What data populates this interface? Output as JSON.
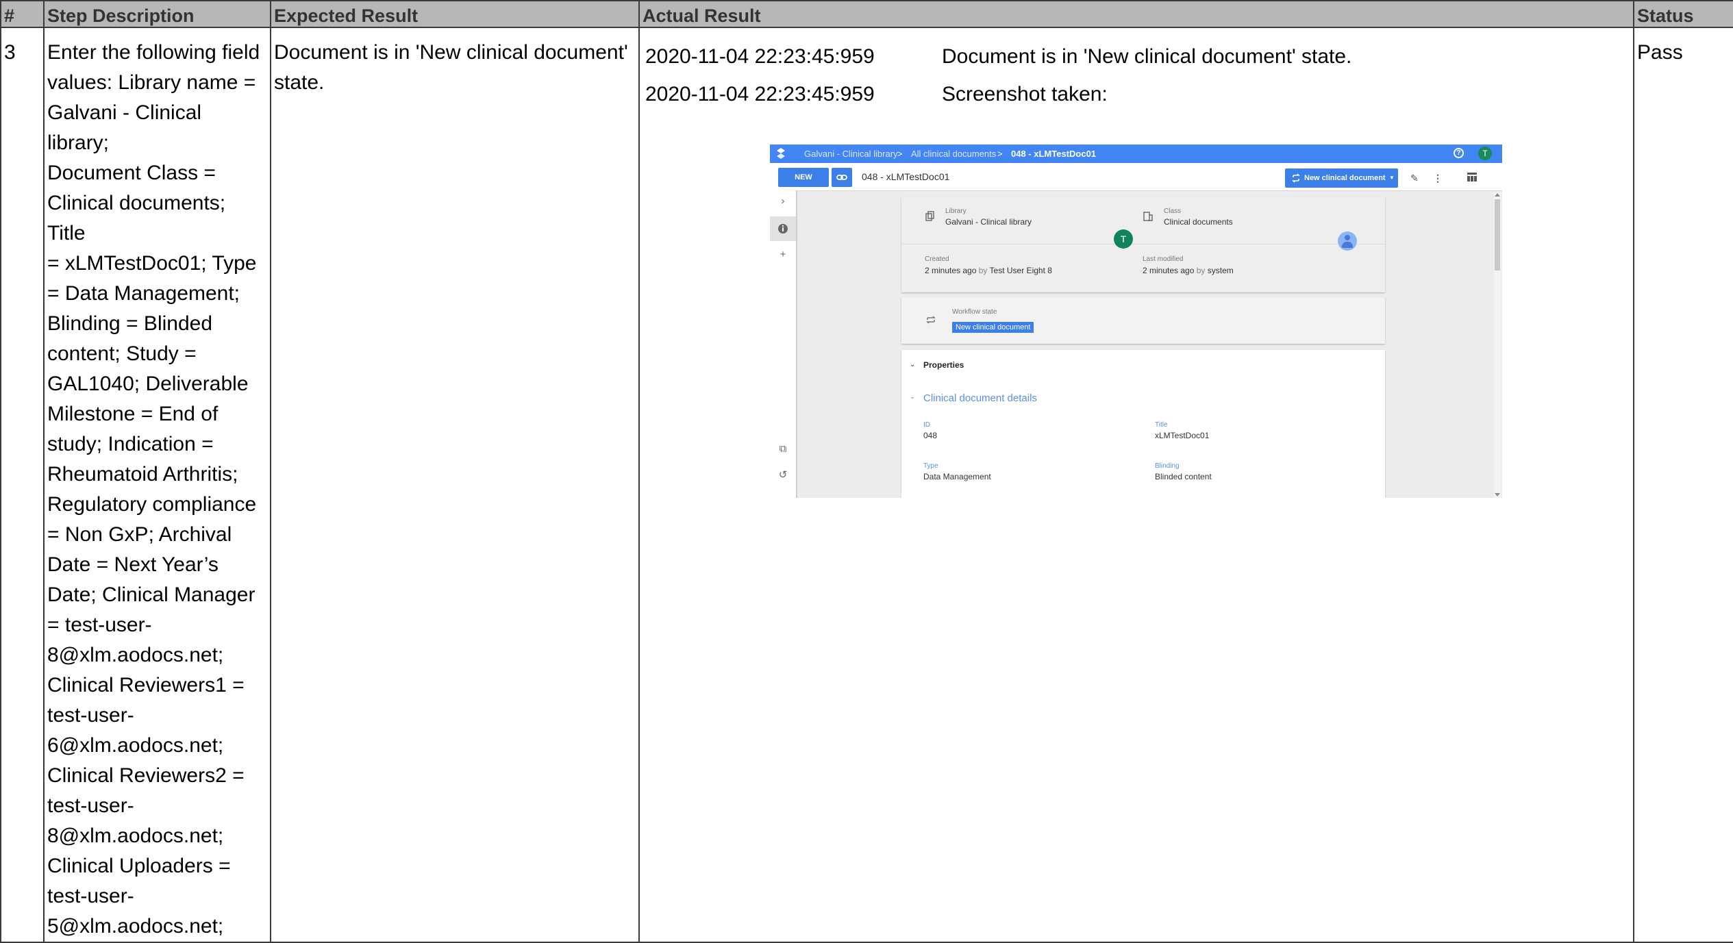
{
  "headers": {
    "num": "#",
    "step": "Step Description",
    "expected": "Expected Result",
    "actual": "Actual Result",
    "status": "Status"
  },
  "row": {
    "num": "3",
    "step_lines": [
      "Enter the following field",
      "values: Library name =",
      "Galvani - Clinical library;",
      "Document Class =",
      "Clinical documents; Title",
      "= xLMTestDoc01; Type",
      "= Data Management;",
      "Blinding = Blinded",
      "content; Study =",
      "GAL1040; Deliverable",
      "Milestone = End of",
      "study; Indication =",
      "Rheumatoid Arthritis;",
      "Regulatory compliance",
      "= Non GxP; Archival",
      "Date = Next Year’s",
      "Date; Clinical Manager",
      "= test-user-",
      "8@xlm.aodocs.net;",
      "Clinical Reviewers1 =",
      "test-user-",
      "6@xlm.aodocs.net;",
      "Clinical Reviewers2 =",
      "test-user-",
      "8@xlm.aodocs.net;",
      "Clinical Uploaders =",
      "test-user-",
      "5@xlm.aodocs.net;"
    ],
    "expected_lines": [
      "Document is in 'New clinical document'",
      "state."
    ],
    "actual": [
      {
        "time": "2020-11-04 22:23:45:959",
        "message": "Document is in 'New clinical document' state."
      },
      {
        "time": "2020-11-04 22:23:45:959",
        "message": "Screenshot taken:"
      }
    ],
    "status": "Pass"
  },
  "screenshot": {
    "breadcrumb": [
      "Galvani - Clinical library",
      "All clinical documents",
      "048 - xLMTestDoc01"
    ],
    "breadcrumb_sep": ">",
    "avatar_letter": "T",
    "new_button": "NEW",
    "doc_name": "048 - xLMTestDoc01",
    "state_button": "New clinical document",
    "library_label": "Library",
    "library_value": "Galvani - Clinical library",
    "class_label": "Class",
    "class_value": "Clinical documents",
    "created_label": "Created",
    "created_ago": "2 minutes ago",
    "created_by_word": "by",
    "created_by": "Test User Eight 8",
    "modified_label": "Last modified",
    "modified_ago": "2 minutes ago",
    "modified_by_word": "by",
    "modified_by": "system",
    "workflow_label": "Workflow state",
    "workflow_value": "New clinical document",
    "properties": "Properties",
    "details": "Clinical document details",
    "fields": {
      "id_label": "ID",
      "id_value": "048",
      "title_label": "Title",
      "title_value": "xLMTestDoc01",
      "type_label": "Type",
      "type_value": "Data Management",
      "blinding_label": "Blinding",
      "blinding_value": "Blinded content"
    },
    "colors": {
      "topbar": "#4285f4",
      "accent": "#3c7fe8",
      "avatar_green": "#12845d"
    }
  }
}
